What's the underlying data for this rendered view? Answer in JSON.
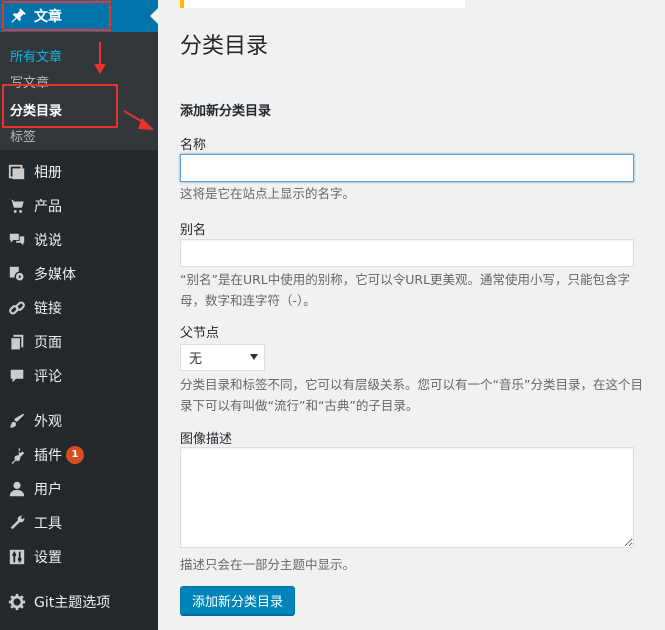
{
  "sidebar": {
    "top_item": {
      "label": "文章",
      "icon": "pin-icon"
    },
    "submenu": [
      {
        "label": "所有文章",
        "state": "current"
      },
      {
        "label": "写文章",
        "state": "normal"
      },
      {
        "label": "分类目录",
        "state": "active"
      },
      {
        "label": "标签",
        "state": "normal"
      }
    ],
    "items": [
      {
        "label": "相册",
        "icon": "gallery-icon"
      },
      {
        "label": "产品",
        "icon": "cart-icon"
      },
      {
        "label": "说说",
        "icon": "chat-icon"
      },
      {
        "label": "多媒体",
        "icon": "media-icon"
      },
      {
        "label": "链接",
        "icon": "link-icon"
      },
      {
        "label": "页面",
        "icon": "pages-icon"
      },
      {
        "label": "评论",
        "icon": "comment-icon"
      },
      {
        "label": "外观",
        "icon": "brush-icon"
      },
      {
        "label": "插件",
        "icon": "plugin-icon",
        "badge": "1"
      },
      {
        "label": "用户",
        "icon": "user-icon"
      },
      {
        "label": "工具",
        "icon": "wrench-icon"
      },
      {
        "label": "设置",
        "icon": "settings-icon"
      },
      {
        "label": "Git主题选项",
        "icon": "gear-icon"
      }
    ]
  },
  "main": {
    "page_title": "分类目录",
    "form": {
      "section_title": "添加新分类目录",
      "name_label": "名称",
      "name_value": "",
      "name_help": "这将是它在站点上显示的名字。",
      "slug_label": "别名",
      "slug_value": "",
      "slug_help": "“别名”是在URL中使用的别称，它可以令URL更美观。通常使用小写，只能包含字母，数字和连字符（-）。",
      "parent_label": "父节点",
      "parent_selected": "无",
      "parent_help": "分类目录和标签不同，它可以有层级关系。您可以有一个“音乐”分类目录，在这个目录下可以有叫做“流行”和“古典”的子目录。",
      "desc_label": "图像描述",
      "desc_value": "",
      "desc_help": "描述只会在一部分主题中显示。",
      "submit_label": "添加新分类目录"
    }
  },
  "colors": {
    "sidebar_bg": "#23282d",
    "submenu_bg": "#32373c",
    "active_menu": "#0073aa",
    "current_link": "#00b9eb",
    "primary_button": "#0085ba",
    "badge": "#d54e21",
    "annotation": "#e8322e",
    "notice_accent": "#ffb900"
  }
}
